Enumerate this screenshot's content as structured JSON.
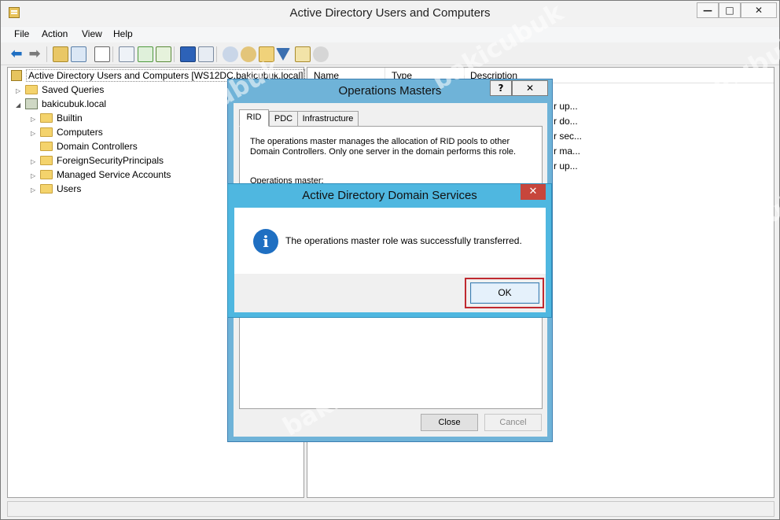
{
  "window": {
    "title": "Active Directory Users and Computers",
    "controls": {
      "minimize": "—",
      "maximize": "□",
      "close": "✕"
    }
  },
  "menu": [
    "File",
    "Action",
    "View",
    "Help"
  ],
  "toolbar_icons": [
    "back-arrow-icon",
    "forward-arrow-icon",
    "up-folder-icon",
    "show-tree-icon",
    "properties-icon",
    "export-list-icon",
    "refresh-icon",
    "export-icon",
    "help-icon",
    "view-icon",
    "new-user-icon",
    "new-group-icon",
    "new-ou-icon",
    "filter-icon",
    "find-icon",
    "add-to-group-icon"
  ],
  "tree": {
    "root": "Active Directory Users and Computers [WS12DC.bakicubuk.local]",
    "items": [
      {
        "label": "Saved Queries",
        "expander": "▷"
      },
      {
        "label": "bakicubuk.local",
        "expander": "◢"
      },
      {
        "label": "Builtin",
        "expander": "▷"
      },
      {
        "label": "Computers",
        "expander": "▷"
      },
      {
        "label": "Domain Controllers",
        "expander": ""
      },
      {
        "label": "ForeignSecurityPrincipals",
        "expander": "▷"
      },
      {
        "label": "Managed Service Accounts",
        "expander": "▷"
      },
      {
        "label": "Users",
        "expander": "▷"
      }
    ]
  },
  "list": {
    "columns": [
      "Name",
      "Type",
      "Description"
    ],
    "descriptions": [
      "r up...",
      "r do...",
      "r sec...",
      "r ma...",
      "r up..."
    ]
  },
  "operations_masters": {
    "title": "Operations Masters",
    "help": "?",
    "close": "✕",
    "tabs": [
      "RID",
      "PDC",
      "Infrastructure"
    ],
    "active_tab": "RID",
    "description": "The operations master manages the allocation of RID pools to other Domain Controllers. Only one server in the domain performs this role.",
    "master_label": "Operations master:",
    "close_button": "Close",
    "cancel_button": "Cancel"
  },
  "message_box": {
    "title": "Active Directory Domain Services",
    "close": "✕",
    "icon": "info-icon",
    "message": "The operations master role was successfully transferred.",
    "ok_button": "OK",
    "highlight_color": "#c0292f"
  },
  "watermark": "bakicubuk"
}
